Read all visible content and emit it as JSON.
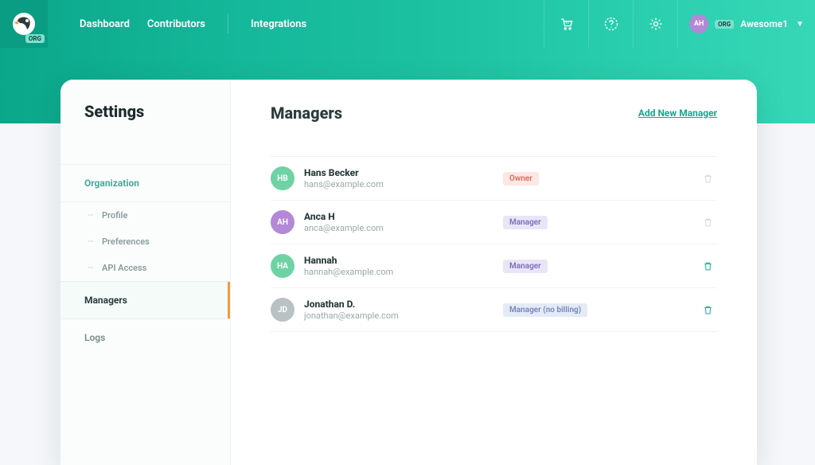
{
  "brand_badge": "ORG",
  "nav": {
    "dashboard": "Dashboard",
    "contributors": "Contributors",
    "integrations": "Integrations"
  },
  "user": {
    "initials": "AH",
    "badge": "ORG",
    "name": "Awesome1"
  },
  "sidebar": {
    "title": "Settings",
    "items": {
      "organization": "Organization",
      "profile": "Profile",
      "preferences": "Preferences",
      "api_access": "API Access",
      "managers": "Managers",
      "logs": "Logs"
    }
  },
  "main": {
    "title": "Managers",
    "add_link": "Add New Manager"
  },
  "role_labels": {
    "owner": "Owner",
    "manager": "Manager",
    "manager_nobilling": "Manager (no billing)"
  },
  "managers": [
    {
      "initials": "HB",
      "name": "Hans Becker",
      "email": "hans@example.com",
      "role": "owner",
      "avatar_color": "#6fd2a5",
      "can_delete": false
    },
    {
      "initials": "AH",
      "name": "Anca H",
      "email": "anca@example.com",
      "role": "manager",
      "avatar_color": "#b388d6",
      "can_delete": false
    },
    {
      "initials": "HA",
      "name": "Hannah",
      "email": "hannah@example.com",
      "role": "manager",
      "avatar_color": "#6fd2a5",
      "can_delete": true
    },
    {
      "initials": "JD",
      "name": "Jonathan D.",
      "email": "jonathan@example.com",
      "role": "manager_nobilling",
      "avatar_color": "#b9c2c2",
      "can_delete": true
    }
  ]
}
